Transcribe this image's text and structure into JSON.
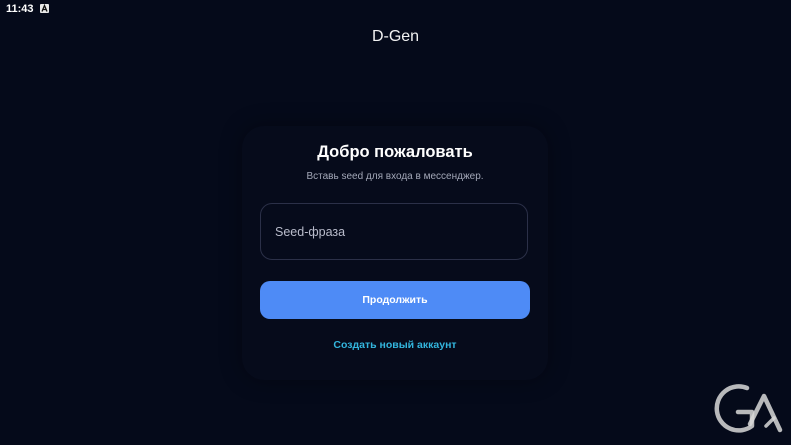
{
  "status_bar": {
    "time": "11:43",
    "indicator_icon": "a-badge-icon"
  },
  "app": {
    "title": "D-Gen"
  },
  "login": {
    "heading": "Добро пожаловать",
    "subtitle": "Вставь seed для входа в мессенджер.",
    "seed_field": {
      "placeholder": "Seed-фраза",
      "value": ""
    },
    "continue_label": "Продолжить",
    "create_account_label": "Создать новый аккаунт"
  },
  "colors": {
    "background": "#050a1a",
    "primary_button": "#4e8bf6",
    "link": "#33b6de",
    "field_border": "#2b3048"
  },
  "watermark": {
    "icon": "ga-logo-icon"
  }
}
